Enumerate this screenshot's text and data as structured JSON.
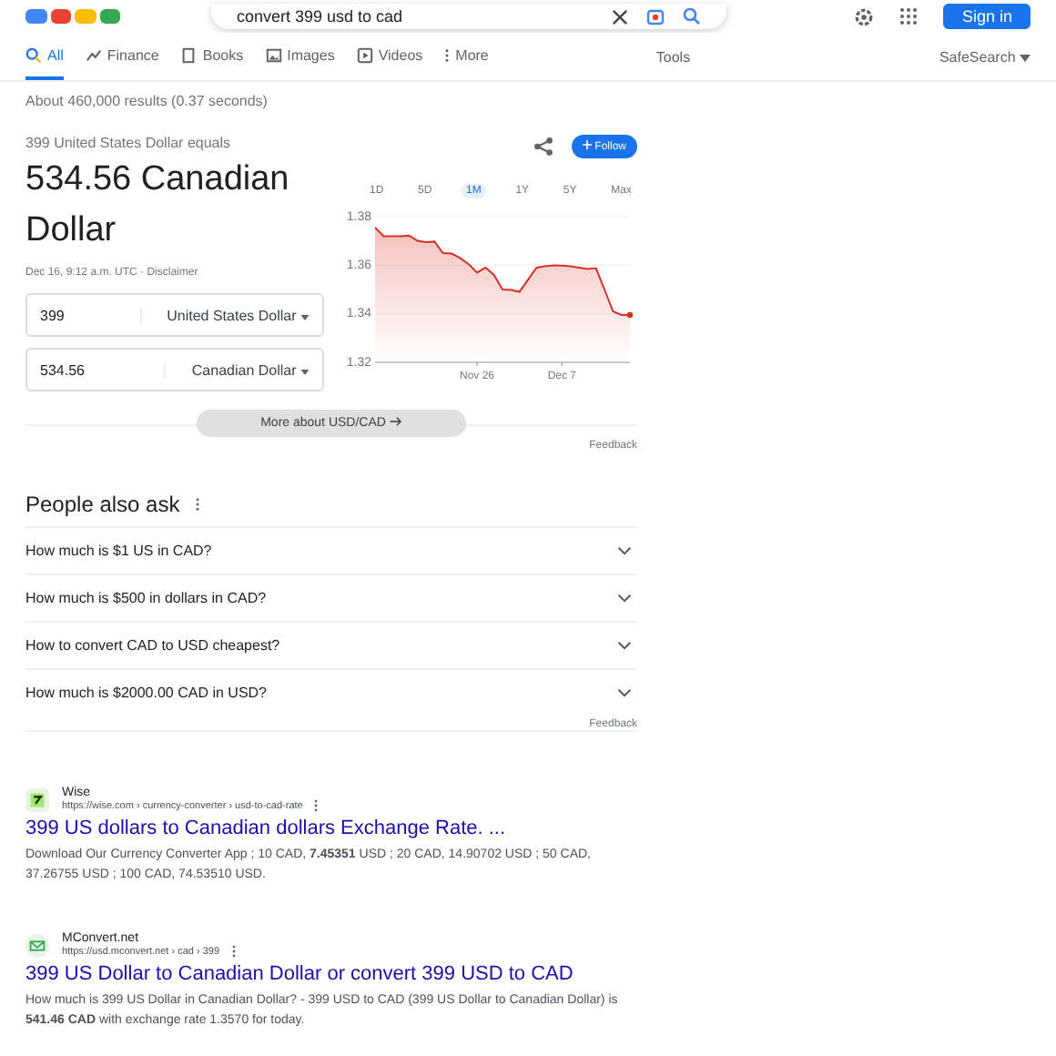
{
  "search": {
    "query": "convert 399 usd to cad",
    "sign_in": "Sign in"
  },
  "tabs": [
    {
      "label": "All",
      "selected": true
    },
    {
      "label": "Finance",
      "selected": false
    },
    {
      "label": "Books",
      "selected": false
    },
    {
      "label": "Images",
      "selected": false
    },
    {
      "label": "Videos",
      "selected": false
    },
    {
      "label": "More",
      "selected": false
    }
  ],
  "tools": "Tools",
  "safesearch": "SafeSearch",
  "result_stats": "About 460,000 results (0.37 seconds)",
  "converter": {
    "equals": "399 United States Dollar equals",
    "result": "534.56 Canadian Dollar",
    "follow": "Follow",
    "timestamp": "Dec 16, 9:12 a.m. UTC · Disclaimer",
    "rows": [
      {
        "amount": "399",
        "currency": "United States Dollar"
      },
      {
        "amount": "534.56",
        "currency": "Canadian Dollar"
      }
    ],
    "ranges": [
      {
        "label": "1D",
        "selected": false
      },
      {
        "label": "5D",
        "selected": false
      },
      {
        "label": "1M",
        "selected": true
      },
      {
        "label": "1Y",
        "selected": false
      },
      {
        "label": "5Y",
        "selected": false
      },
      {
        "label": "Max",
        "selected": false
      }
    ],
    "chart_data": {
      "type": "area",
      "categories": [
        null,
        null,
        null,
        null,
        null,
        null,
        null,
        null,
        null,
        null,
        null,
        null,
        "Nov 26",
        null,
        null,
        null,
        null,
        null,
        null,
        null,
        null,
        null,
        "Dec 7",
        null,
        null,
        null,
        null,
        null,
        null,
        null,
        null
      ],
      "series": [
        {
          "color": "#d93025",
          "values": [
            1.3755,
            1.372,
            1.372,
            1.372,
            1.3722,
            1.37,
            1.3695,
            1.3697,
            1.365,
            1.3648,
            1.363,
            1.3605,
            1.357,
            1.359,
            1.356,
            1.35,
            1.3498,
            1.349,
            1.354,
            1.359,
            1.3595,
            1.36,
            1.3598,
            1.3595,
            1.359,
            1.3585,
            1.3588,
            1.35,
            1.341,
            1.3395,
            1.3395
          ]
        }
      ],
      "ylim": [
        1.32,
        1.38
      ],
      "yticks": [
        {
          "value": 1.32,
          "label": "1.32"
        },
        {
          "value": 1.34,
          "label": "1.34"
        },
        {
          "value": 1.36,
          "label": "1.36"
        },
        {
          "value": 1.38,
          "label": "1.38"
        }
      ]
    },
    "more": "More about USD/CAD",
    "feedback": "Feedback"
  },
  "people_also_ask": {
    "title": "People also ask",
    "questions": [
      "How much is $1 US in CAD?",
      "How much is $500 in dollars in CAD?",
      "How to convert CAD to USD cheapest?",
      "How much is $2000.00 CAD in USD?"
    ],
    "feedback": "Feedback"
  },
  "results": [
    {
      "site": "Wise",
      "url": "https://wise.com › currency-converter › usd-to-cad-rate",
      "title": "399 US dollars to Canadian dollars Exchange Rate. ...",
      "snippet": "Download Our Currency Converter App ; 10 CAD, **7.45351** USD ; 20 CAD, 14.90702 USD ; 50 CAD, 37.26755 USD ; 100 CAD, 74.53510 USD."
    },
    {
      "site": "MConvert.net",
      "url": "https://usd.mconvert.net › cad › 399",
      "title": "399 US Dollar to Canadian Dollar or convert 399 USD to CAD",
      "snippet": "How much is 399 US Dollar in Canadian Dollar? - 399 USD to CAD (399 US Dollar to Canadian Dollar) is **541.46 CAD** with exchange rate 1.3570 for today."
    }
  ]
}
